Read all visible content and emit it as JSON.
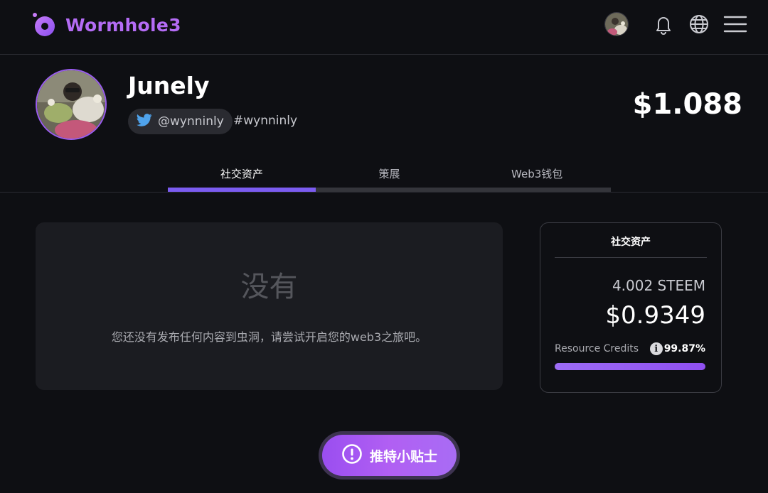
{
  "app": {
    "logo_text": "Wormhole3",
    "brand_color": "#b46cf5"
  },
  "nav": {
    "icons": [
      "avatar",
      "bell-icon",
      "globe-icon",
      "menu-icon"
    ]
  },
  "profile": {
    "name": "Junely",
    "twitter_handle": "@wynninly",
    "hashtag": "#wynninly",
    "total_value": "$1.088"
  },
  "tabs": [
    {
      "label": "社交资产",
      "active": true
    },
    {
      "label": "策展",
      "active": false
    },
    {
      "label": "Web3钱包",
      "active": false
    }
  ],
  "empty_state": {
    "title": "没有",
    "description": "您还没有发布任何内容到虫洞，请尝试开启您的web3之旅吧。"
  },
  "assets_card": {
    "title": "社交资产",
    "steem_amount": "4.002 STEEM",
    "usd_amount": "$0.9349",
    "resource_credits_label": "Resource Credits",
    "resource_credits_value": "99.87%",
    "resource_credits_fraction": 0.9987
  },
  "tips_button": {
    "label": "推特小贴士"
  }
}
